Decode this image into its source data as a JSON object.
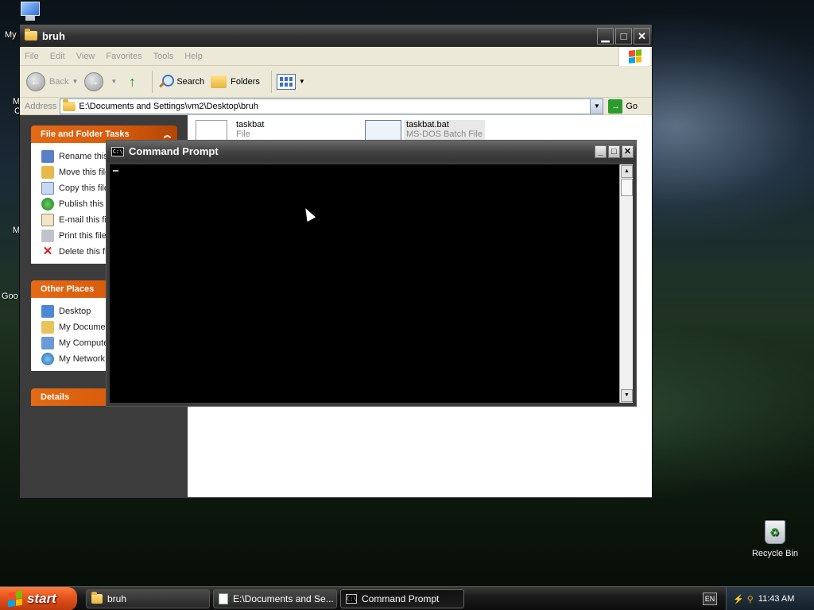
{
  "desktop": {
    "icons_edge": [
      "My",
      "M",
      "C",
      "M",
      "Goo"
    ],
    "recycle_bin": "Recycle Bin"
  },
  "explorer": {
    "title": "bruh",
    "menu": [
      "File",
      "Edit",
      "View",
      "Favorites",
      "Tools",
      "Help"
    ],
    "toolbar": {
      "back": "Back",
      "search": "Search",
      "folders": "Folders"
    },
    "address_label": "Address",
    "address_value": "E:\\Documents and Settings\\vm2\\Desktop\\bruh",
    "go_label": "Go",
    "file_tasks": {
      "header": "File and Folder Tasks",
      "items": [
        "Rename this file",
        "Move this file",
        "Copy this file",
        "Publish this file to the Web",
        "E-mail this file",
        "Print this file",
        "Delete this file"
      ]
    },
    "other_places": {
      "header": "Other Places",
      "items": [
        "Desktop",
        "My Documents",
        "My Computer",
        "My Network Places"
      ]
    },
    "details": {
      "header": "Details"
    },
    "files": [
      {
        "name": "taskbat",
        "type": "File"
      },
      {
        "name": "taskbat.bat",
        "type": "MS-DOS Batch File"
      }
    ]
  },
  "cmd": {
    "title": "Command Prompt",
    "icon_text": "C:\\"
  },
  "taskbar": {
    "start": "start",
    "buttons": [
      "bruh",
      "E:\\Documents and Se...",
      "Command Prompt"
    ],
    "lang": "EN",
    "clock": "11:43 AM"
  }
}
